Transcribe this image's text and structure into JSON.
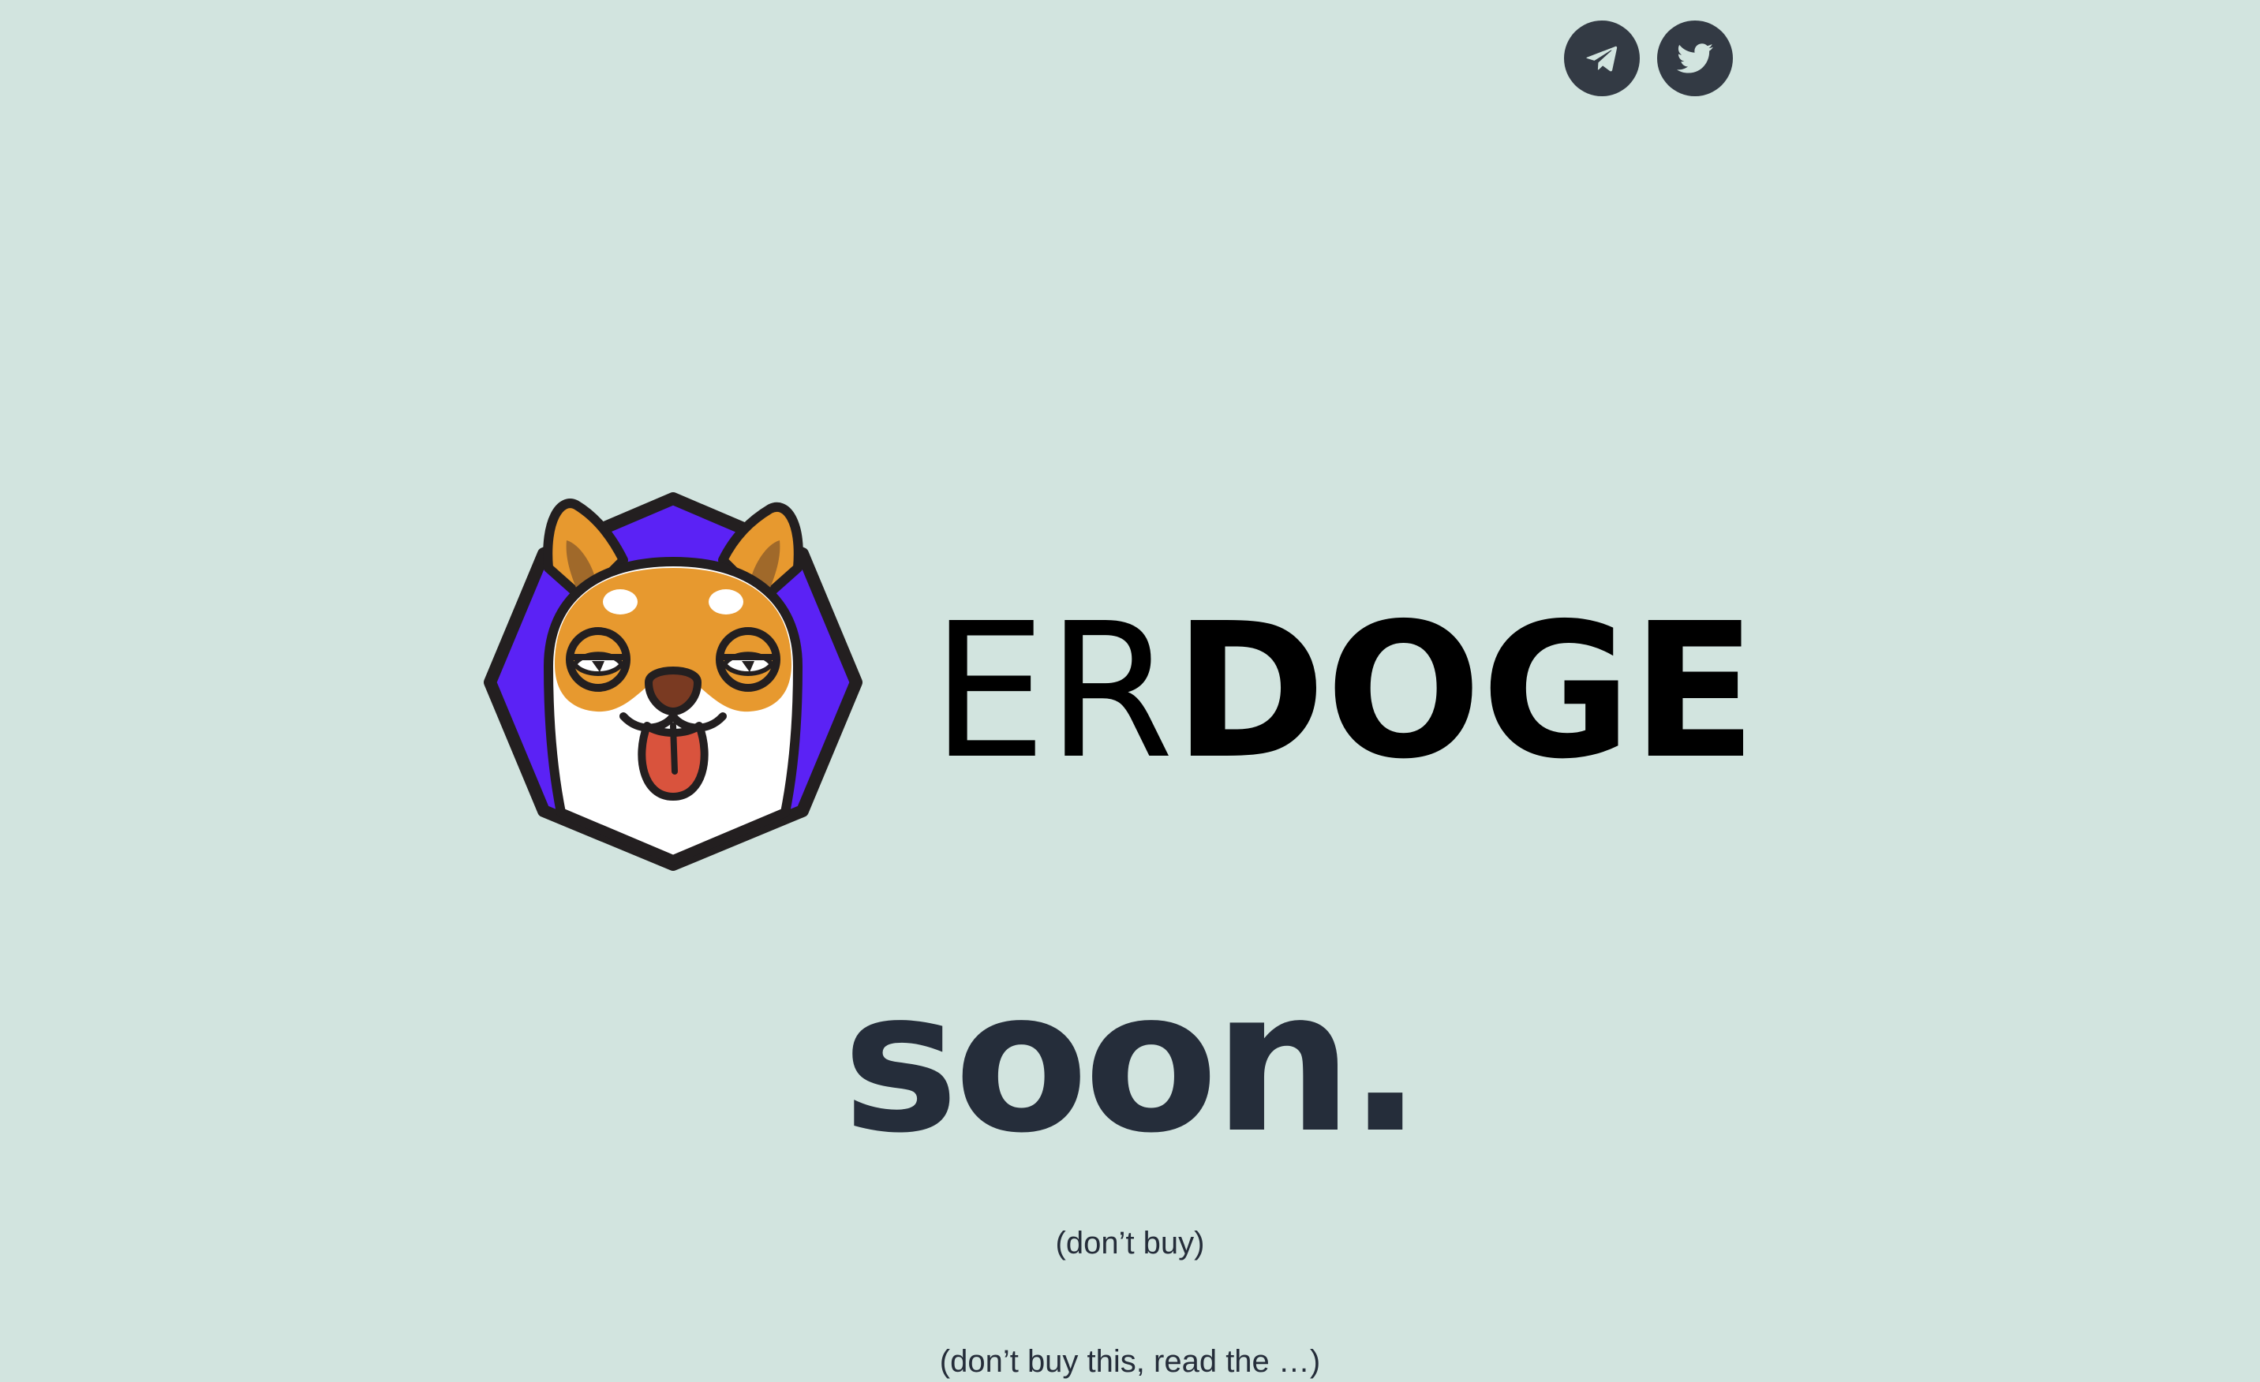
{
  "header": {
    "social_links": [
      {
        "name": "Telegram",
        "icon": "telegram-icon"
      },
      {
        "name": "Twitter",
        "icon": "twitter-icon"
      }
    ]
  },
  "hero": {
    "logo_text_light": "ER",
    "logo_text_bold": "DOGE",
    "headline": "soon.",
    "subtext": "(don’t buy)",
    "subtext_2": "(don’t buy this, read the …)"
  },
  "colors": {
    "background": "#d2e4df",
    "text": "#252d3a",
    "social_button": "#333a44",
    "hexagon": "#5b22f5",
    "shiba_orange": "#e7992f",
    "tongue": "#d9533d",
    "outline": "#231f20"
  }
}
